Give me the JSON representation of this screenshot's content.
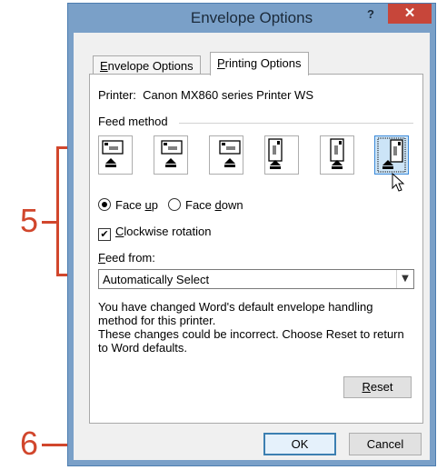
{
  "window": {
    "title": "Envelope Options",
    "help_label": "?",
    "close_label": "✕"
  },
  "tabs": [
    {
      "label_pre": "",
      "label_ul": "E",
      "label_post": "nvelope Options",
      "selected": false
    },
    {
      "label_pre": "",
      "label_ul": "P",
      "label_post": "rinting Options",
      "selected": true
    }
  ],
  "printer": {
    "label": "Printer:",
    "value": "Canon MX860 series Printer WS"
  },
  "feed_method": {
    "label": "Feed method",
    "options": [
      {
        "name": "feed-horizontal-left",
        "selected": false
      },
      {
        "name": "feed-horizontal-center",
        "selected": false
      },
      {
        "name": "feed-horizontal-right",
        "selected": false
      },
      {
        "name": "feed-vertical-left",
        "selected": false
      },
      {
        "name": "feed-vertical-center",
        "selected": false
      },
      {
        "name": "feed-vertical-right",
        "selected": true
      }
    ]
  },
  "face": {
    "up": {
      "pre": "Face ",
      "ul": "u",
      "post": "p",
      "checked": true
    },
    "down": {
      "pre": "Face ",
      "ul": "d",
      "post": "own",
      "checked": false
    }
  },
  "clockwise": {
    "ul": "C",
    "post": "lockwise rotation",
    "checked": true,
    "mark": "✔"
  },
  "feed_from": {
    "ul": "F",
    "post": "eed from:",
    "value": "Automatically Select",
    "arrow": "▼"
  },
  "message": {
    "line1": "You have changed Word's default envelope handling method for this printer.",
    "line2": "These changes could be incorrect. Choose Reset to return to Word defaults."
  },
  "buttons": {
    "reset_ul": "R",
    "reset_post": "eset",
    "ok": "OK",
    "cancel": "Cancel"
  },
  "callouts": {
    "five": "5",
    "six": "6"
  },
  "colors": {
    "accent": "#d1462c",
    "window_frame": "#7aa0c8",
    "close": "#c7463a"
  }
}
